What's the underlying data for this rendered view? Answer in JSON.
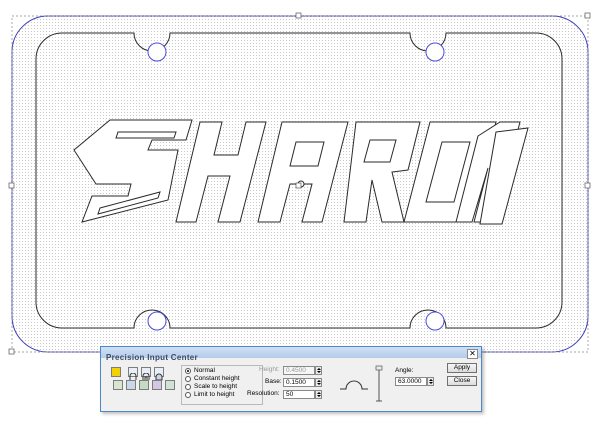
{
  "artwork": {
    "text": "SHARON",
    "outline_color": "#2a2a2a",
    "selection_color": "#3b3bbd",
    "hole_color": "#4a4ae0",
    "fill_dot_color": "#cfcfcf"
  },
  "dialog": {
    "title": "Precision Input Center",
    "close_glyph": "✕",
    "modes": [
      "Normal",
      "Constant height",
      "Scale to height",
      "Limit to height"
    ],
    "selected_mode": "Normal",
    "height": {
      "label": "Height:",
      "value": "0.4500"
    },
    "base": {
      "label": "Base:",
      "value": "0.1500"
    },
    "resolution": {
      "label": "Resolution:",
      "value": "50"
    },
    "angle": {
      "label": "Angle:",
      "value": "63.0000"
    },
    "apply_label": "Apply",
    "close_label": "Close",
    "accent": "#f2d200"
  }
}
